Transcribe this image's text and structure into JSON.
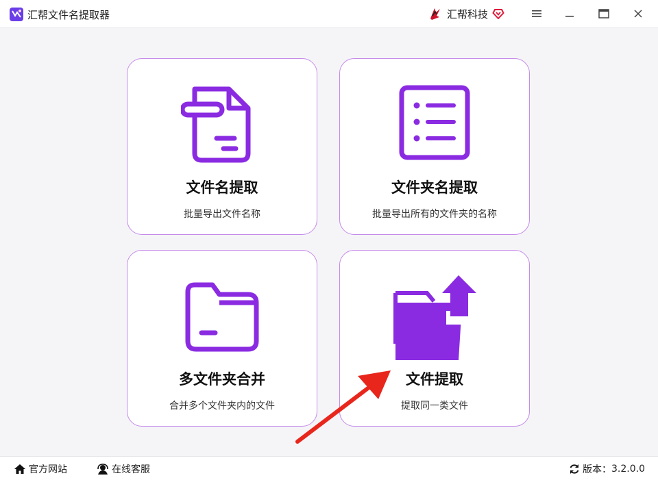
{
  "window": {
    "title": "汇帮文件名提取器",
    "brand": "汇帮科技"
  },
  "cards": [
    {
      "title": "文件名提取",
      "desc": "批量导出文件名称",
      "icon": "document-icon"
    },
    {
      "title": "文件夹名提取",
      "desc": "批量导出所有的文件夹的名称",
      "icon": "list-icon"
    },
    {
      "title": "多文件夹合并",
      "desc": "合并多个文件夹内的文件",
      "icon": "folder-icon"
    },
    {
      "title": "文件提取",
      "desc": "提取同一类文件",
      "icon": "folder-upload-icon"
    }
  ],
  "footer": {
    "website": "官方网站",
    "support": "在线客服",
    "version_label": "版本：",
    "version": "3.2.0.0"
  },
  "colors": {
    "accent": "#8a2be2",
    "card_border": "#c58be8",
    "arrow": "#e8261c"
  }
}
